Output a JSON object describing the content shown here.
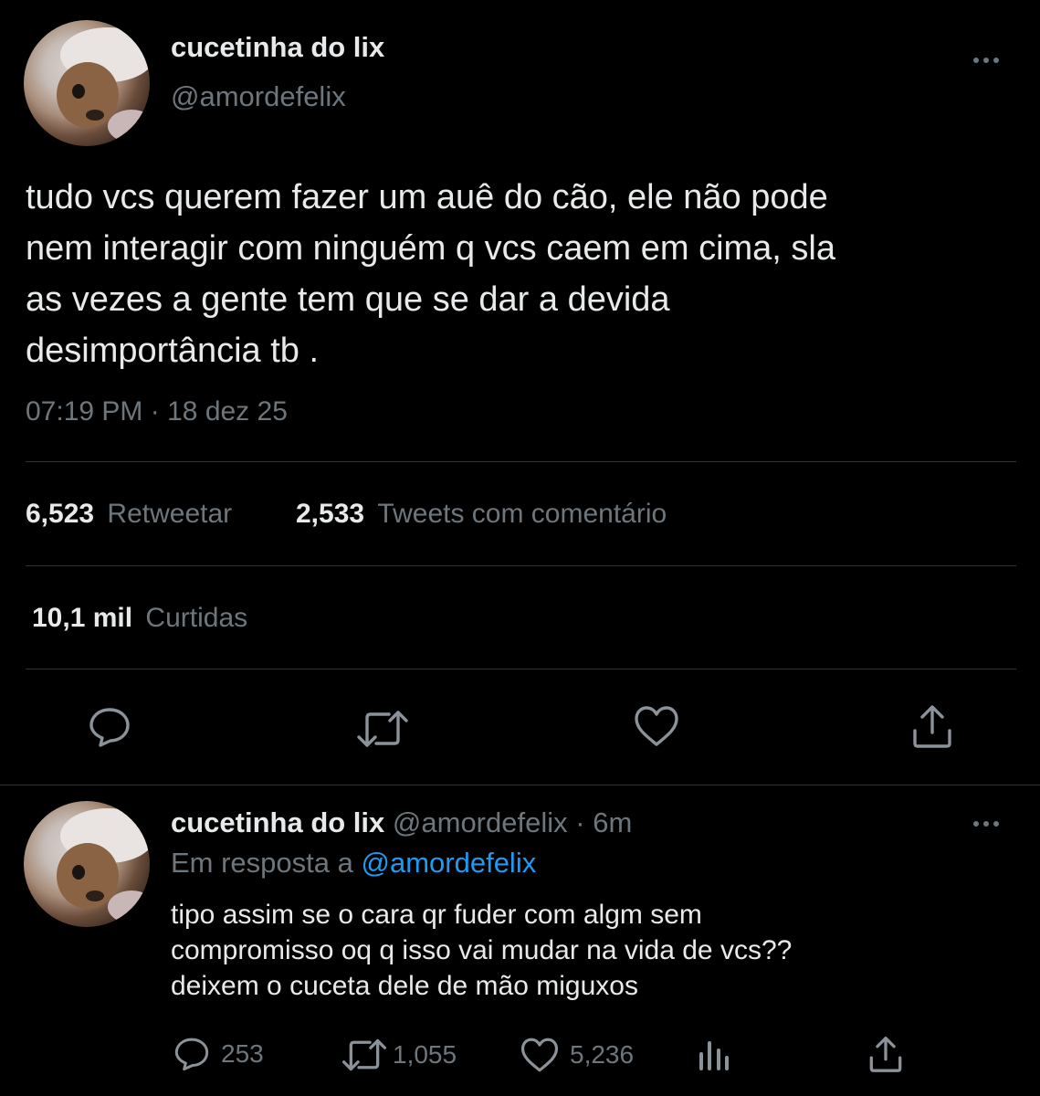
{
  "tweet": {
    "display_name": "cucetinha do lix",
    "handle": "@amordefelix",
    "text_lines": [
      "tudo vcs querem fazer um auê do cão, ele não pode",
      "nem interagir com ninguém q vcs caem em cima, sla",
      "as vezes a gente tem que se dar a devida",
      "desimportância tb ."
    ],
    "time": "07:19 PM",
    "dot": "·",
    "date": "18 dez 25",
    "retweets_count": "6,523",
    "retweets_label": "Retweetar",
    "quotes_count": "2,533",
    "quotes_label": "Tweets com comentário",
    "likes_count": "10,1 mil",
    "likes_label": "Curtidas",
    "avatar_icon": "avatar-dog-cowboy-hat"
  },
  "reply": {
    "display_name": "cucetinha do lix",
    "handle": "@amordefelix",
    "dot": "·",
    "age": "6m",
    "replying_to_label": "Em resposta a",
    "replying_to_handle": "@amordefelix",
    "text_lines": [
      "tipo assim se o cara qr fuder com algm sem",
      "compromisso oq q isso vai mudar na vida de vcs??",
      "deixem o cuceta dele de mão miguxos"
    ],
    "reply_count": "253",
    "retweet_count": "1,055",
    "like_count": "5,236"
  },
  "colors": {
    "background": "#000000",
    "text": "#e7e9ea",
    "muted": "#6e767d",
    "link": "#1d9bf0",
    "divider": "#2f3336"
  }
}
